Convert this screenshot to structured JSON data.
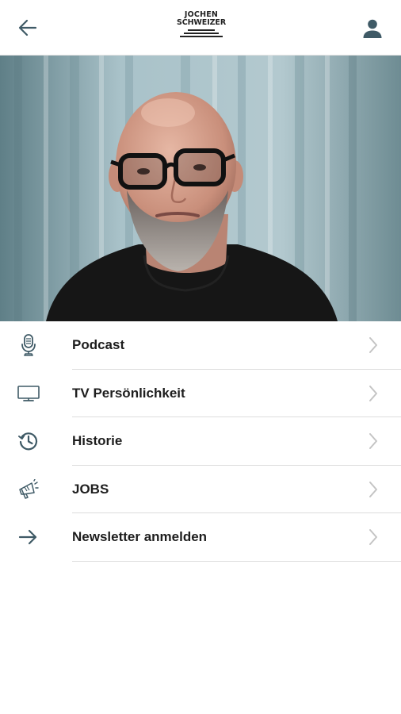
{
  "header": {
    "logo_line1": "JOCHEN",
    "logo_line2": "SCHWEIZER"
  },
  "menu": {
    "items": [
      {
        "label": "Podcast",
        "icon": "microphone-icon"
      },
      {
        "label": "TV Persönlichkeit",
        "icon": "tv-icon"
      },
      {
        "label": "Historie",
        "icon": "history-icon"
      },
      {
        "label": "JOBS",
        "icon": "megaphone-icon"
      },
      {
        "label": "Newsletter anmelden",
        "icon": "arrow-right-icon"
      }
    ]
  },
  "colors": {
    "icon": "#3f5a66",
    "chevron": "#c4c4c4",
    "divider": "#dcdcdc",
    "text": "#1e1e1e"
  }
}
